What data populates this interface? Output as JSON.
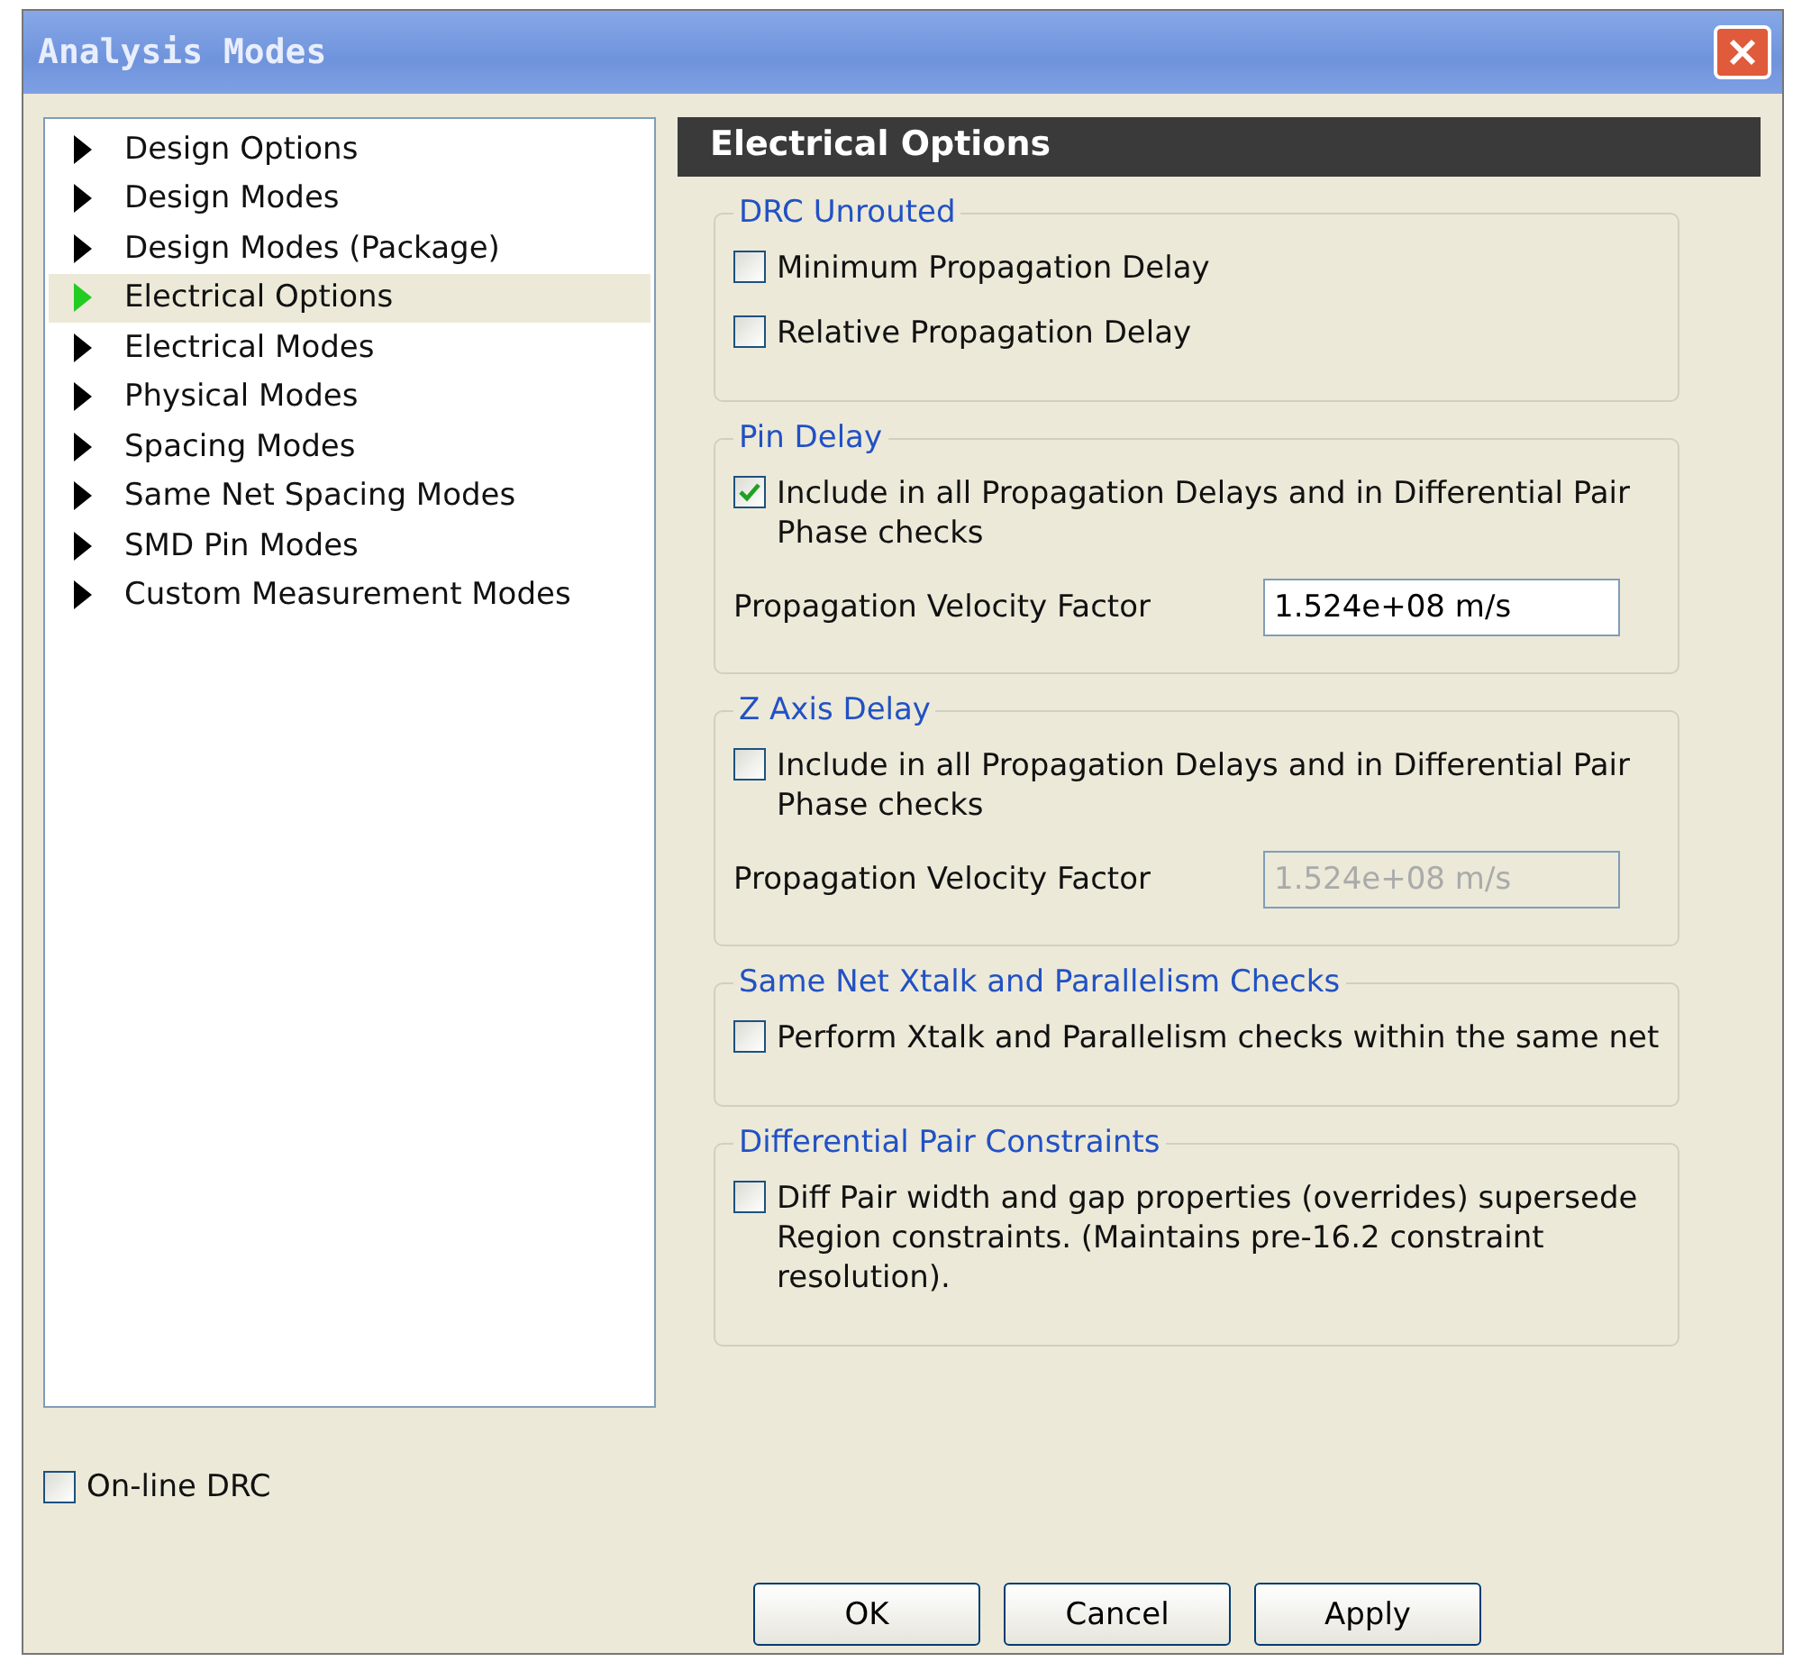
{
  "window": {
    "title": "Analysis Modes"
  },
  "sidebar": {
    "items": [
      {
        "label": "Design Options",
        "selected": false
      },
      {
        "label": "Design Modes",
        "selected": false
      },
      {
        "label": "Design Modes (Package)",
        "selected": false
      },
      {
        "label": "Electrical Options",
        "selected": true
      },
      {
        "label": "Electrical Modes",
        "selected": false
      },
      {
        "label": "Physical Modes",
        "selected": false
      },
      {
        "label": "Spacing Modes",
        "selected": false
      },
      {
        "label": "Same Net Spacing Modes",
        "selected": false
      },
      {
        "label": "SMD Pin Modes",
        "selected": false
      },
      {
        "label": "Custom Measurement Modes",
        "selected": false
      }
    ]
  },
  "online_drc": {
    "label": "On-line DRC",
    "checked": false
  },
  "panel": {
    "title": "Electrical Options",
    "groups": [
      {
        "title": "DRC Unrouted",
        "items": [
          {
            "kind": "checkbox",
            "label": "Minimum Propagation Delay",
            "checked": false
          },
          {
            "kind": "checkbox",
            "label": "Relative Propagation Delay",
            "checked": false
          }
        ]
      },
      {
        "title": "Pin Delay",
        "items": [
          {
            "kind": "checkbox",
            "label": "Include in all Propagation Delays and in Differential Pair Phase checks",
            "checked": true
          },
          {
            "kind": "field",
            "label": "Propagation Velocity Factor",
            "value": "1.524e+08 m/s",
            "disabled": false
          }
        ]
      },
      {
        "title": "Z Axis Delay",
        "items": [
          {
            "kind": "checkbox",
            "label": "Include in all Propagation Delays and in Differential Pair Phase checks",
            "checked": false
          },
          {
            "kind": "field",
            "label": "Propagation Velocity Factor",
            "value": "1.524e+08 m/s",
            "disabled": true
          }
        ]
      },
      {
        "title": "Same Net Xtalk and Parallelism Checks",
        "items": [
          {
            "kind": "checkbox",
            "label": "Perform Xtalk and Parallelism checks within the same net",
            "checked": false
          }
        ]
      },
      {
        "title": "Differential Pair Constraints",
        "items": [
          {
            "kind": "checkbox",
            "label": "Diff Pair width and gap properties (overrides) supersede Region constraints. (Maintains pre-16.2 constraint resolution).",
            "checked": false
          }
        ]
      }
    ]
  },
  "buttons": [
    "OK",
    "Cancel",
    "Apply"
  ]
}
